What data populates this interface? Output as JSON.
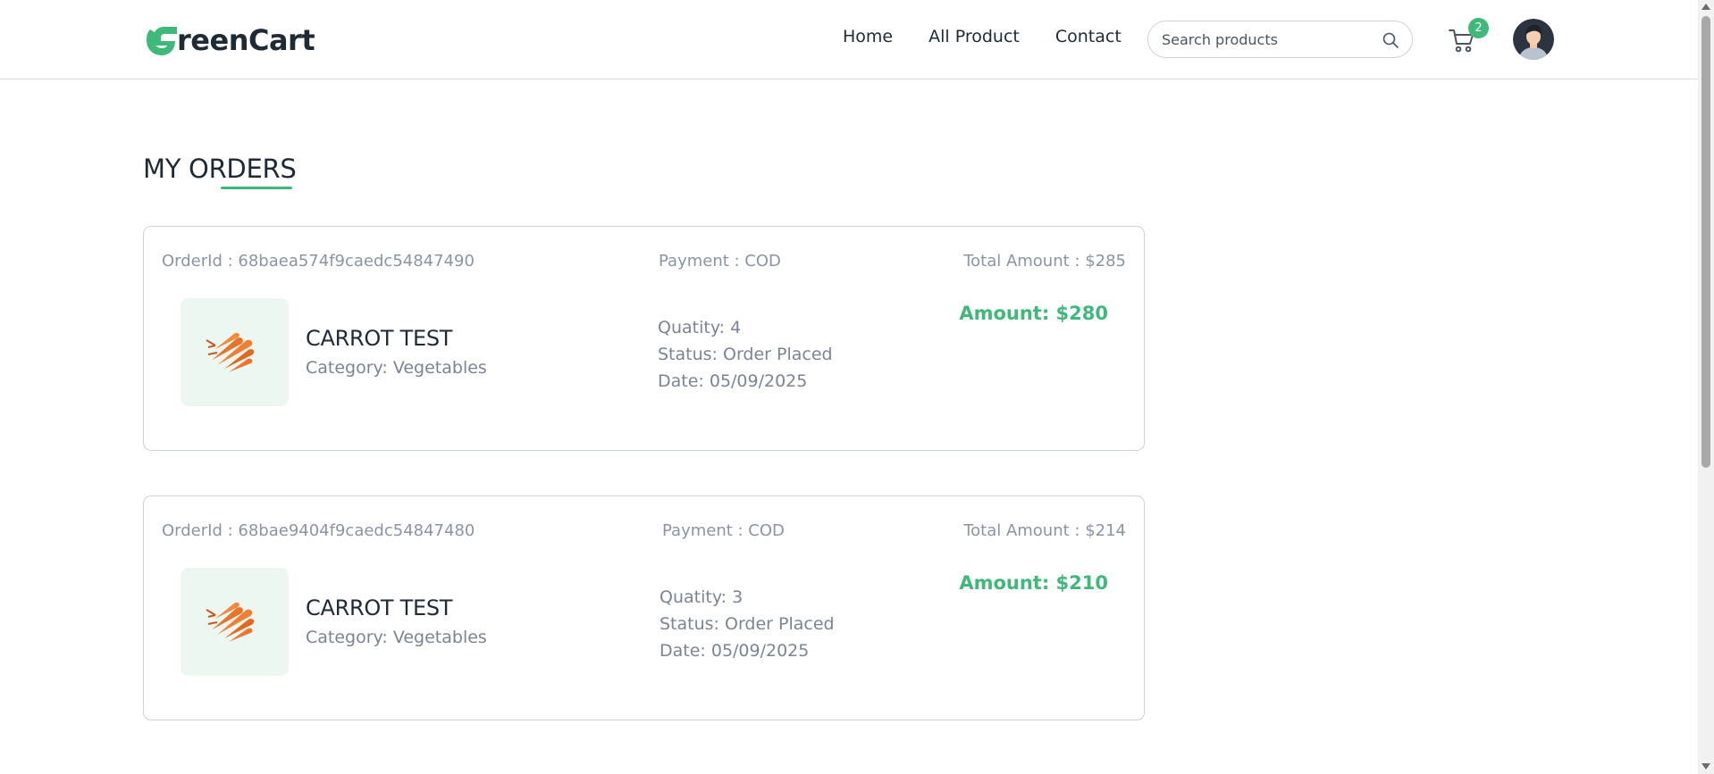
{
  "header": {
    "logo_text": "reenCart",
    "logo_letter": "G",
    "nav": [
      "Home",
      "All Product",
      "Contact"
    ],
    "search_placeholder": "Search products",
    "cart_count": "2",
    "accent_color": "#3fb97a"
  },
  "page": {
    "title": "MY ORDERS"
  },
  "orders": [
    {
      "order_id": "OrderId : 68baea574f9caedc54847490",
      "payment": "Payment : COD",
      "total": "Total Amount : $285",
      "product_name": "CARROT TEST",
      "category": "Category: Vegetables",
      "quantity": "Quatity: 4",
      "status": "Status: Order Placed",
      "date": "Date: 05/09/2025",
      "amount": "Amount: $280",
      "image_icon": "carrot-icon"
    },
    {
      "order_id": "OrderId : 68bae9404f9caedc54847480",
      "payment": "Payment : COD",
      "total": "Total Amount : $214",
      "product_name": "CARROT TEST",
      "category": "Category: Vegetables",
      "quantity": "Quatity: 3",
      "status": "Status: Order Placed",
      "date": "Date: 05/09/2025",
      "amount": "Amount: $210",
      "image_icon": "carrot-icon"
    }
  ]
}
